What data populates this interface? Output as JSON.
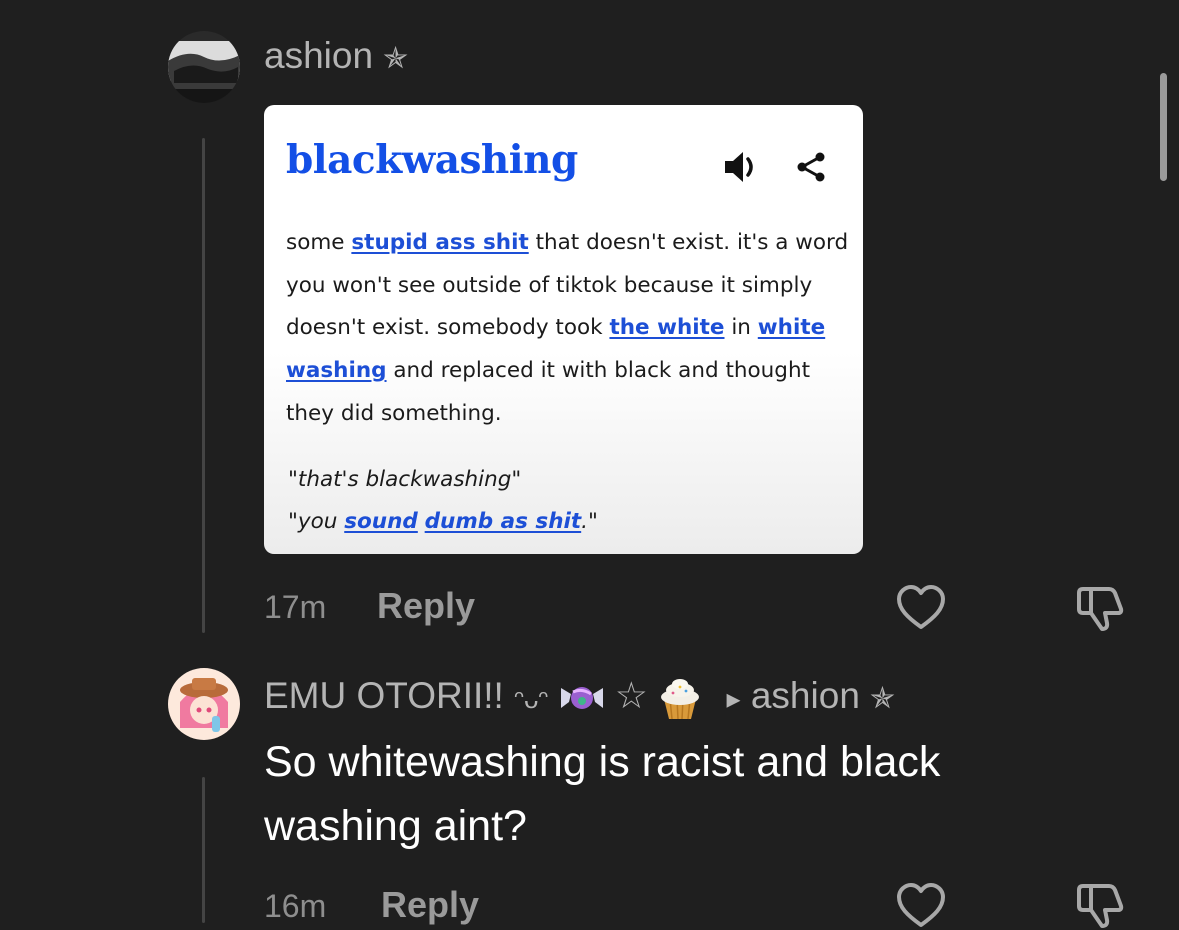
{
  "comment1": {
    "username": "ashion",
    "sigil": "✯",
    "time": "17m",
    "reply_label": "Reply",
    "card": {
      "word": "blackwashing",
      "def_1": "some ",
      "link_1": "stupid ass shit",
      "def_2": " that doesn't exist. it's a word you won't see outside of tiktok because it simply doesn't exist. somebody took ",
      "link_2": "the white",
      "def_3": " in ",
      "link_3": "white washing",
      "def_4": " and replaced it with black and thought they did something.",
      "example_1": "\"that's blackwashing\"",
      "example_2a": "\"you ",
      "example_link_1": "sound",
      "example_link_2": "dumb as shit",
      "example_2b": ".\""
    }
  },
  "comment2": {
    "username": "EMU OTORII!!",
    "emoticon": "ᵔᴗᵔ",
    "star": "☆",
    "arrow": "▸",
    "reply_to": "ashion",
    "sigil": "✯",
    "text": "So whitewashing is racist and black washing aint?",
    "time": "16m",
    "reply_label": "Reply"
  },
  "icons": [
    "like-heart-icon",
    "dislike-thumb-icon",
    "speaker-icon",
    "share-icon",
    "candy-emoji",
    "cupcake-emoji"
  ],
  "colors": {
    "background": "#1f1f1f",
    "link_blue": "#1d4fd6",
    "meta_gray": "#8e8e8e"
  }
}
